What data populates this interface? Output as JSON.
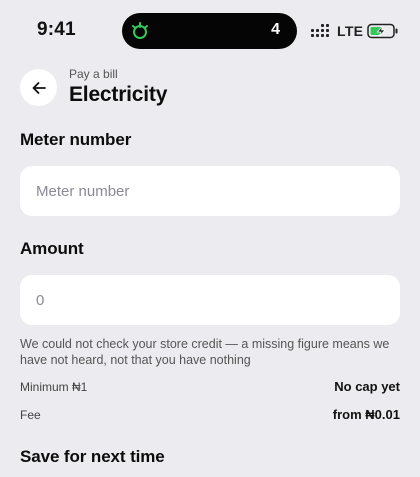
{
  "status_bar": {
    "time": "9:41",
    "island_count": "4",
    "network": "LTE",
    "icons": [
      "island-app-icon",
      "signal-icon",
      "battery-charging-icon"
    ],
    "accent": "#34c759"
  },
  "header": {
    "back_icon": "arrow-left-icon",
    "eyebrow": "Pay a bill",
    "title": "Electricity"
  },
  "meter": {
    "label": "Meter number",
    "placeholder": "Meter number",
    "value": ""
  },
  "amount": {
    "label": "Amount",
    "placeholder": "0",
    "value": ""
  },
  "notice": "We could not check your store credit — a missing figure means we have not heard, not that you have nothing",
  "limits": {
    "minimum_label": "Minimum ₦1",
    "cap_value": "No cap yet",
    "fee_label": "Fee",
    "fee_value": "from ₦0.01"
  },
  "save_section": {
    "label": "Save for next time"
  }
}
